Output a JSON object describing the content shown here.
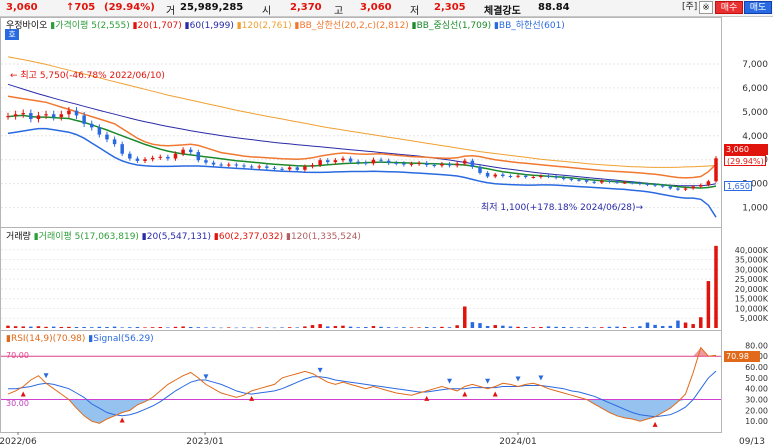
{
  "header": {
    "price": "3,060",
    "change": "↑705",
    "change_pct": "(29.94%)",
    "volume_label": "거",
    "volume": "25,989,285",
    "open_label": "시",
    "open": "2,370",
    "high_label": "고",
    "high": "3,060",
    "low_label": "저",
    "low": "2,305",
    "strength_label": "체결강도",
    "strength": "88.84",
    "bracket_btn": "[주]",
    "gear_btn": "※",
    "buy_btn": "매수",
    "sell_btn": "매도"
  },
  "price_panel": {
    "stock_name": "우정바이오",
    "ho_badge": "호",
    "legend": [
      {
        "label": "가격이평 5(2,555)",
        "color": "#2e9e3a"
      },
      {
        "label": "20(1,707)",
        "color": "#e0140c"
      },
      {
        "label": "60(1,999)",
        "color": "#2a2aa8"
      },
      {
        "label": "120(2,761)",
        "color": "#f0a030"
      },
      {
        "label": "BB_상한선(20,2,c)(2,812)",
        "color": "#f07830"
      },
      {
        "label": "BB_중심선(1,709)",
        "color": "#1a8a2a"
      },
      {
        "label": "BB_하한선(601)",
        "color": "#2a6ae0"
      }
    ],
    "hi_annot": "← 최고 5,750(-46.78% 2022/06/10)",
    "lo_annot": "최저 1,100(+178.18% 2024/06/28)→",
    "badge_price": "3,060",
    "badge_pct": "(29.94%)",
    "badge_low": "1,650"
  },
  "volume_panel": {
    "title": "거래량",
    "legend": [
      {
        "label": "거래이평 5(17,063,819)",
        "color": "#2e9e3a"
      },
      {
        "label": "20(5,547,131)",
        "color": "#2a2aa8"
      },
      {
        "label": "60(2,377,032)",
        "color": "#e0140c"
      },
      {
        "label": "120(1,335,524)",
        "color": "#b06060"
      }
    ],
    "unit": "K"
  },
  "rsi_panel": {
    "legend": [
      {
        "label": "RSI(14,9)(70.98)",
        "color": "#e06a1a"
      },
      {
        "label": "Signal(56.29)",
        "color": "#2a6ae0"
      }
    ],
    "line70": "70.00",
    "line30": "30.00",
    "badge": "70.98"
  },
  "x_axis": {
    "labels": [
      "2022/06",
      "2023/01",
      "2024/01",
      "09/13"
    ]
  },
  "chart_data": [
    {
      "type": "candlestick",
      "title": "우정바이오",
      "yticks": [
        1000,
        2000,
        3000,
        4000,
        5000,
        6000,
        7000
      ],
      "ylim": [
        400,
        8000
      ],
      "close": [
        4820,
        4900,
        4950,
        4700,
        4850,
        4900,
        4780,
        4900,
        5050,
        4850,
        4500,
        4350,
        4050,
        3850,
        3650,
        3250,
        3050,
        2950,
        3020,
        3080,
        3120,
        3050,
        3250,
        3420,
        3320,
        2980,
        2880,
        2800,
        2780,
        2800,
        2760,
        2720,
        2680,
        2720,
        2660,
        2620,
        2600,
        2680,
        2580,
        2720,
        2780,
        2980,
        2900,
        2980,
        3050,
        2920,
        2880,
        2850,
        3000,
        2960,
        2870,
        2850,
        2800,
        2830,
        2860,
        2780,
        2760,
        2820,
        2760,
        2840,
        2960,
        2700,
        2450,
        2300,
        2380,
        2320,
        2300,
        2330,
        2280,
        2280,
        2320,
        2300,
        2250,
        2200,
        2160,
        2150,
        2080,
        2050,
        2120,
        2080,
        2050,
        2050,
        2030,
        1990,
        1960,
        1920,
        1880,
        1800,
        1750,
        1800,
        1880,
        1950,
        2100,
        3060
      ],
      "ma20": [
        4800,
        4830,
        4850,
        4800,
        4780,
        4780,
        4760,
        4740,
        4720,
        4640,
        4560,
        4460,
        4350,
        4240,
        4120,
        4000,
        3880,
        3760,
        3640,
        3540,
        3440,
        3360,
        3300,
        3240,
        3200,
        3160,
        3120,
        3080,
        3040,
        3000,
        2960,
        2930,
        2900,
        2870,
        2840,
        2810,
        2790,
        2770,
        2750,
        2740,
        2740,
        2760,
        2790,
        2810,
        2840,
        2850,
        2860,
        2880,
        2890,
        2900,
        2890,
        2880,
        2870,
        2860,
        2850,
        2840,
        2830,
        2820,
        2810,
        2800,
        2780,
        2740,
        2680,
        2620,
        2560,
        2500,
        2460,
        2420,
        2380,
        2350,
        2330,
        2310,
        2290,
        2270,
        2240,
        2210,
        2180,
        2150,
        2120,
        2100,
        2080,
        2060,
        2040,
        2020,
        2000,
        1980,
        1950,
        1920,
        1880,
        1850,
        1830,
        1820,
        1840,
        1900
      ],
      "ma60": [
        6150,
        6050,
        5950,
        5850,
        5750,
        5660,
        5570,
        5480,
        5400,
        5320,
        5230,
        5150,
        5060,
        4980,
        4900,
        4820,
        4740,
        4660,
        4590,
        4520,
        4450,
        4390,
        4330,
        4270,
        4210,
        4160,
        4110,
        4060,
        4010,
        3960,
        3920,
        3880,
        3840,
        3800,
        3760,
        3720,
        3690,
        3660,
        3630,
        3600,
        3570,
        3540,
        3510,
        3480,
        3450,
        3420,
        3390,
        3360,
        3330,
        3300,
        3270,
        3240,
        3210,
        3180,
        3150,
        3110,
        3070,
        3030,
        2990,
        2940,
        2890,
        2840,
        2790,
        2740,
        2690,
        2640,
        2600,
        2560,
        2520,
        2480,
        2440,
        2410,
        2380,
        2350,
        2320,
        2290,
        2260,
        2230,
        2200,
        2170,
        2140,
        2110,
        2080,
        2050,
        2020,
        1990,
        1960,
        1940,
        1920,
        1910,
        1910,
        1920,
        1940,
        1999
      ],
      "ma120": [
        7300,
        7240,
        7180,
        7120,
        7050,
        6980,
        6900,
        6820,
        6740,
        6660,
        6580,
        6500,
        6420,
        6340,
        6260,
        6180,
        6100,
        6020,
        5940,
        5860,
        5780,
        5700,
        5630,
        5560,
        5490,
        5420,
        5350,
        5280,
        5210,
        5140,
        5070,
        5000,
        4940,
        4880,
        4820,
        4760,
        4700,
        4640,
        4580,
        4520,
        4460,
        4400,
        4340,
        4290,
        4240,
        4190,
        4140,
        4090,
        4040,
        3990,
        3940,
        3890,
        3840,
        3790,
        3740,
        3690,
        3640,
        3590,
        3540,
        3490,
        3440,
        3390,
        3340,
        3300,
        3260,
        3220,
        3180,
        3140,
        3100,
        3060,
        3020,
        2990,
        2960,
        2930,
        2900,
        2870,
        2840,
        2810,
        2790,
        2770,
        2750,
        2730,
        2710,
        2700,
        2690,
        2680,
        2680,
        2680,
        2690,
        2700,
        2710,
        2720,
        2740,
        2761
      ],
      "bb_upper": [
        5650,
        5600,
        5550,
        5500,
        5450,
        5400,
        5300,
        5200,
        5100,
        5000,
        4900,
        4800,
        4700,
        4600,
        4500,
        4300,
        4100,
        3900,
        3750,
        3650,
        3600,
        3580,
        3600,
        3620,
        3650,
        3600,
        3500,
        3400,
        3300,
        3250,
        3200,
        3150,
        3120,
        3100,
        3080,
        3060,
        3040,
        3030,
        3020,
        3040,
        3080,
        3150,
        3200,
        3250,
        3280,
        3260,
        3240,
        3230,
        3240,
        3250,
        3220,
        3190,
        3160,
        3130,
        3120,
        3100,
        3080,
        3070,
        3060,
        3080,
        3150,
        3170,
        3130,
        3060,
        3000,
        2960,
        2920,
        2880,
        2850,
        2820,
        2790,
        2760,
        2730,
        2700,
        2670,
        2640,
        2610,
        2580,
        2550,
        2530,
        2510,
        2490,
        2470,
        2450,
        2420,
        2390,
        2350,
        2300,
        2260,
        2240,
        2260,
        2300,
        2500,
        2812
      ],
      "bb_lower": [
        4100,
        4150,
        4200,
        4250,
        4300,
        4300,
        4250,
        4200,
        4150,
        4050,
        3900,
        3700,
        3500,
        3300,
        3100,
        2950,
        2850,
        2780,
        2750,
        2730,
        2720,
        2720,
        2730,
        2740,
        2740,
        2740,
        2720,
        2700,
        2680,
        2660,
        2640,
        2620,
        2600,
        2580,
        2560,
        2540,
        2520,
        2510,
        2500,
        2480,
        2470,
        2470,
        2480,
        2490,
        2500,
        2510,
        2510,
        2510,
        2520,
        2510,
        2500,
        2490,
        2480,
        2460,
        2440,
        2420,
        2400,
        2380,
        2350,
        2320,
        2260,
        2180,
        2100,
        2040,
        2000,
        1980,
        1960,
        1950,
        1940,
        1940,
        1950,
        1950,
        1940,
        1920,
        1900,
        1880,
        1860,
        1840,
        1820,
        1800,
        1780,
        1760,
        1730,
        1700,
        1660,
        1610,
        1550,
        1490,
        1430,
        1400,
        1400,
        1350,
        1100,
        601
      ]
    },
    {
      "type": "bar",
      "title": "거래량",
      "yticks": [
        5000,
        10000,
        15000,
        20000,
        25000,
        30000,
        35000,
        40000
      ],
      "tick_labels": [
        "5,000K",
        "10,000K",
        "15,000K",
        "20,000K",
        "25,000K",
        "30,000K",
        "35,000K",
        "40,000K"
      ],
      "ylim": [
        0,
        45000
      ],
      "values": [
        1200,
        900,
        800,
        700,
        900,
        600,
        700,
        500,
        600,
        500,
        500,
        400,
        600,
        500,
        700,
        300,
        400,
        500,
        300,
        400,
        500,
        300,
        600,
        800,
        500,
        400,
        300,
        300,
        200,
        300,
        200,
        300,
        200,
        300,
        300,
        200,
        300,
        400,
        300,
        800,
        1500,
        2000,
        800,
        1000,
        1200,
        700,
        400,
        500,
        1000,
        600,
        400,
        300,
        400,
        300,
        300,
        500,
        400,
        600,
        400,
        1400,
        11000,
        3000,
        2500,
        1000,
        1500,
        1200,
        800,
        600,
        500,
        400,
        500,
        800,
        600,
        500,
        400,
        300,
        500,
        300,
        400,
        600,
        700,
        500,
        400,
        900,
        2800,
        1600,
        1000,
        1100,
        3800,
        2800,
        2000,
        5500,
        24000,
        42000
      ]
    },
    {
      "type": "line",
      "title": "RSI(14,9)",
      "yticks": [
        10,
        20,
        30,
        40,
        50,
        60,
        70,
        80
      ],
      "ylim": [
        0,
        85
      ],
      "series": [
        {
          "name": "RSI(14,9)",
          "values": [
            35,
            38,
            42,
            48,
            52,
            45,
            40,
            35,
            30,
            22,
            15,
            10,
            8,
            12,
            15,
            18,
            20,
            25,
            28,
            32,
            38,
            44,
            48,
            52,
            55,
            50,
            44,
            40,
            36,
            34,
            32,
            34,
            38,
            40,
            42,
            44,
            50,
            52,
            54,
            56,
            54,
            50,
            46,
            44,
            46,
            44,
            42,
            40,
            42,
            40,
            38,
            36,
            35,
            34,
            36,
            38,
            40,
            42,
            40,
            38,
            42,
            44,
            42,
            40,
            42,
            45,
            44,
            42,
            44,
            45,
            43,
            40,
            38,
            36,
            34,
            32,
            30,
            26,
            22,
            18,
            15,
            13,
            12,
            10,
            12,
            14,
            18,
            22,
            28,
            35,
            55,
            78,
            70,
            71
          ]
        },
        {
          "name": "Signal",
          "values": [
            40,
            40,
            41,
            42,
            44,
            45,
            44,
            42,
            40,
            36,
            32,
            26,
            22,
            18,
            16,
            15,
            16,
            18,
            21,
            24,
            28,
            33,
            38,
            42,
            46,
            48,
            48,
            46,
            44,
            41,
            38,
            36,
            35,
            36,
            37,
            38,
            40,
            43,
            46,
            49,
            51,
            51,
            50,
            48,
            47,
            46,
            45,
            44,
            43,
            42,
            41,
            40,
            39,
            38,
            37,
            37,
            38,
            39,
            40,
            40,
            40,
            41,
            41,
            41,
            41,
            42,
            42,
            42,
            43,
            43,
            43,
            42,
            41,
            40,
            38,
            37,
            35,
            33,
            30,
            27,
            24,
            21,
            18,
            16,
            15,
            14,
            15,
            16,
            19,
            23,
            30,
            40,
            50,
            56.29
          ]
        }
      ],
      "hlines": [
        70,
        30
      ]
    }
  ]
}
